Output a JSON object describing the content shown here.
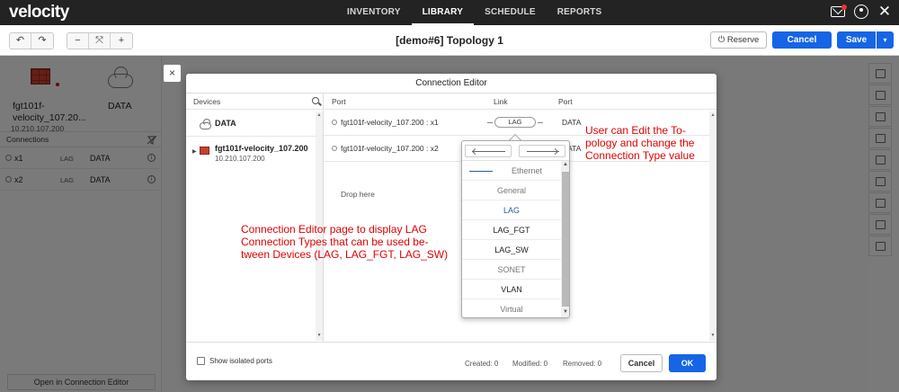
{
  "app": {
    "logo": "velocity"
  },
  "nav": {
    "links": [
      "INVENTORY",
      "LIBRARY",
      "SCHEDULE",
      "REPORTS"
    ],
    "active": "LIBRARY"
  },
  "toolbar": {
    "undo_icon": "↶",
    "redo_icon": "↷",
    "zoom_out": "−",
    "fit_icon": "⤧",
    "zoom_in": "+",
    "title": "[demo#6] Topology 1",
    "reserve_label": "⏻ Reserve",
    "cancel_label": "Cancel",
    "save_label": "Save",
    "save_dropdown": "▾"
  },
  "left_panel": {
    "device1_name": "fgt101f-velocity_107.20...",
    "device1_ip": "10.210.107.200",
    "device2_name": "DATA",
    "connections_title": "Connections",
    "connections": [
      {
        "port": "x1",
        "type": "LAG",
        "dest": "DATA"
      },
      {
        "port": "x2",
        "type": "LAG",
        "dest": "DATA"
      }
    ],
    "open_button": "Open in Connection Editor"
  },
  "modal": {
    "close": "×",
    "title": "Connection Editor",
    "devices_header": "Devices",
    "devices": [
      {
        "name": "DATA",
        "icon": "cloud-icon"
      },
      {
        "name": "fgt101f-velocity_107.200",
        "ip": "10.210.107.200",
        "icon": "firewall-icon"
      }
    ],
    "port_header": "Port",
    "link_header": "Link",
    "dest_header": "Port",
    "rows": [
      {
        "port": "fgt101f-velocity_107.200 : x1",
        "link": "LAG",
        "dest": "DATA"
      },
      {
        "port": "fgt101f-velocity_107.200 : x2",
        "dest": "DATA"
      }
    ],
    "drop_here": "Drop here",
    "show_isolated": "Show isolated ports",
    "created": "Created: 0",
    "modified": "Modified: 0",
    "removed": "Removed: 0",
    "cancel_label": "Cancel",
    "ok_label": "OK"
  },
  "dropdown": {
    "options": [
      "Ethernet",
      "General",
      "LAG",
      "LAG_FGT",
      "LAG_SW",
      "SONET",
      "VLAN",
      "Virtual"
    ],
    "selected": "LAG"
  },
  "annotations": {
    "right_line1": "User can Edit the To-",
    "right_line2": "pology and change the",
    "right_line3": "Connection Type value",
    "center_line1": "Connection Editor page to display LAG",
    "center_line2": "Connection Types that can be used be-",
    "center_line3": "tween Devices (LAG, LAG_FGT, LAG_SW)"
  },
  "colors": {
    "primary": "#1565e6",
    "annotation": "#e00000",
    "nav_bg": "#232323",
    "selected_option": "#2c5aa8"
  }
}
